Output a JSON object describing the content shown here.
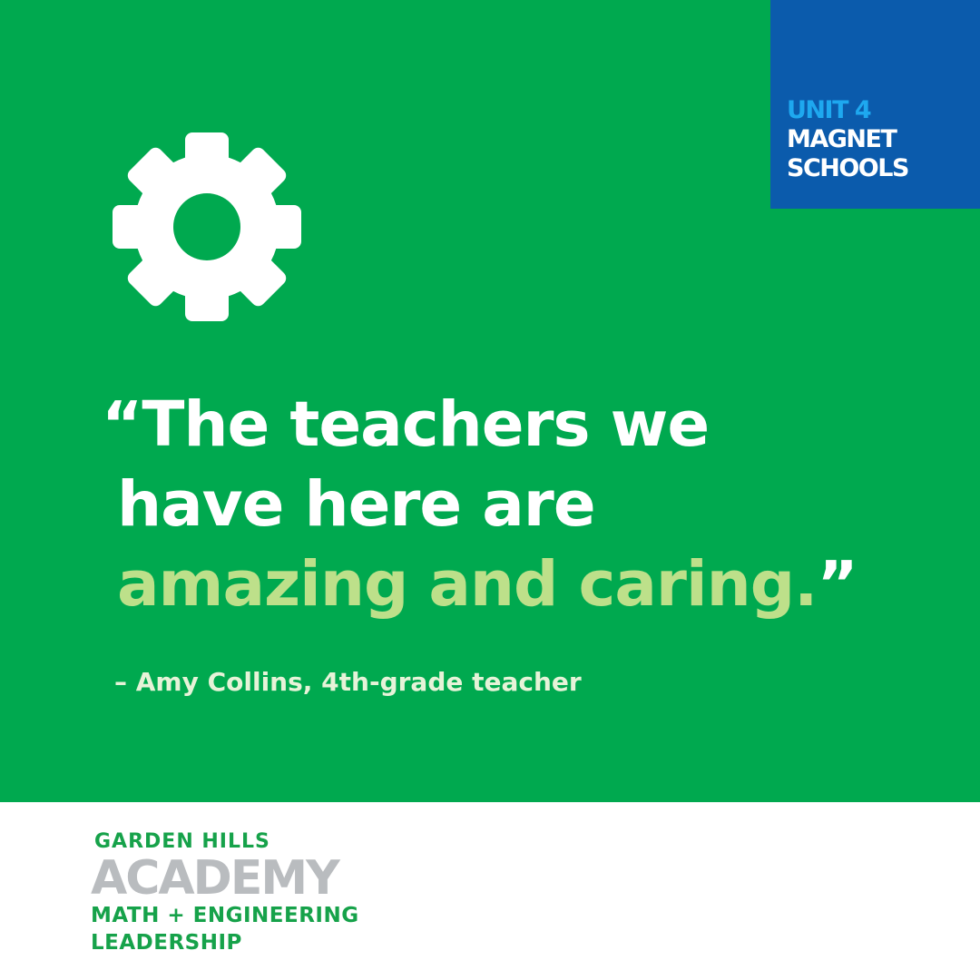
{
  "colors": {
    "primary_green": "#00a94f",
    "badge_blue": "#0b5bac",
    "unit_blue": "#1ea8ef",
    "highlight_green": "#bde08a",
    "logo_green": "#16a24a",
    "logo_gray": "#b9bcbf",
    "white": "#ffffff"
  },
  "badge": {
    "unit": "UNIT 4",
    "series_line1": "MAGNET",
    "series_line2": "SCHOOLS"
  },
  "icon": "gear-icon",
  "quote": {
    "line1": "“The teachers we",
    "line2": "have here are",
    "line3_highlight": "amazing and caring.",
    "line3_close": "”"
  },
  "attribution": "– Amy Collins, 4th-grade teacher",
  "logo": {
    "top": "GARDEN HILLS",
    "name": "ACADEMY",
    "sub1": "MATH + ENGINEERING",
    "sub2": "LEADERSHIP"
  }
}
